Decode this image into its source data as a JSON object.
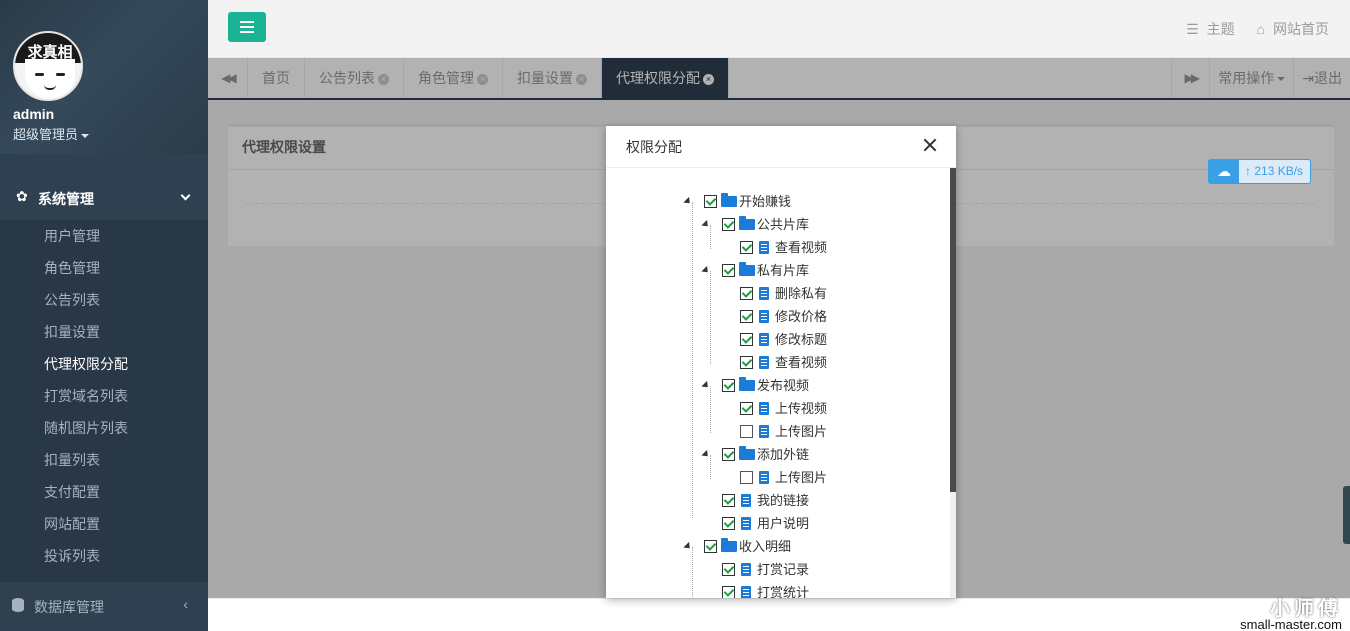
{
  "sidebar": {
    "avatar_text": "求真相",
    "username": "admin",
    "role": "超级管理员",
    "section_title": "系统管理",
    "items": [
      {
        "label": "用户管理",
        "active": false
      },
      {
        "label": "角色管理",
        "active": false
      },
      {
        "label": "公告列表",
        "active": false
      },
      {
        "label": "扣量设置",
        "active": false
      },
      {
        "label": "代理权限分配",
        "active": true
      },
      {
        "label": "打赏域名列表",
        "active": false
      },
      {
        "label": "随机图片列表",
        "active": false
      },
      {
        "label": "扣量列表",
        "active": false
      },
      {
        "label": "支付配置",
        "active": false
      },
      {
        "label": "网站配置",
        "active": false
      },
      {
        "label": "投诉列表",
        "active": false
      }
    ],
    "db_section": "数据库管理"
  },
  "topbar": {
    "theme": "主题",
    "home": "网站首页"
  },
  "tabs": {
    "items": [
      {
        "label": "首页",
        "closable": false,
        "active": false
      },
      {
        "label": "公告列表",
        "closable": true,
        "active": false
      },
      {
        "label": "角色管理",
        "closable": true,
        "active": false
      },
      {
        "label": "扣量设置",
        "closable": true,
        "active": false
      },
      {
        "label": "代理权限分配",
        "closable": true,
        "active": true
      }
    ],
    "common_ops": "常用操作",
    "logout": "退出"
  },
  "panel": {
    "title": "代理权限设置"
  },
  "speed_widget": {
    "value": "213 KB/s"
  },
  "modal": {
    "title": "权限分配",
    "tree": [
      {
        "label": "开始赚钱",
        "level": 0,
        "type": "folder",
        "checked": true
      },
      {
        "label": "公共片库",
        "level": 1,
        "type": "folder",
        "checked": true
      },
      {
        "label": "查看视频",
        "level": 2,
        "type": "doc",
        "checked": true
      },
      {
        "label": "私有片库",
        "level": 1,
        "type": "folder",
        "checked": true
      },
      {
        "label": "删除私有",
        "level": 2,
        "type": "doc",
        "checked": true
      },
      {
        "label": "修改价格",
        "level": 2,
        "type": "doc",
        "checked": true
      },
      {
        "label": "修改标题",
        "level": 2,
        "type": "doc",
        "checked": true
      },
      {
        "label": "查看视频",
        "level": 2,
        "type": "doc",
        "checked": true
      },
      {
        "label": "发布视频",
        "level": 1,
        "type": "folder",
        "checked": true
      },
      {
        "label": "上传视频",
        "level": 2,
        "type": "doc",
        "checked": true
      },
      {
        "label": "上传图片",
        "level": 2,
        "type": "doc",
        "checked": false
      },
      {
        "label": "添加外链",
        "level": 1,
        "type": "folder",
        "checked": true
      },
      {
        "label": "上传图片",
        "level": 2,
        "type": "doc",
        "checked": false
      },
      {
        "label": "我的链接",
        "level": 1,
        "type": "doc",
        "checked": true
      },
      {
        "label": "用户说明",
        "level": 1,
        "type": "doc",
        "checked": true
      },
      {
        "label": "收入明细",
        "level": 0,
        "type": "folder",
        "checked": true
      },
      {
        "label": "打赏记录",
        "level": 1,
        "type": "doc",
        "checked": true
      },
      {
        "label": "打赏统计",
        "level": 1,
        "type": "doc",
        "checked": true
      }
    ]
  },
  "watermark": {
    "line1": "小师傅",
    "line2": "small-master.com"
  }
}
